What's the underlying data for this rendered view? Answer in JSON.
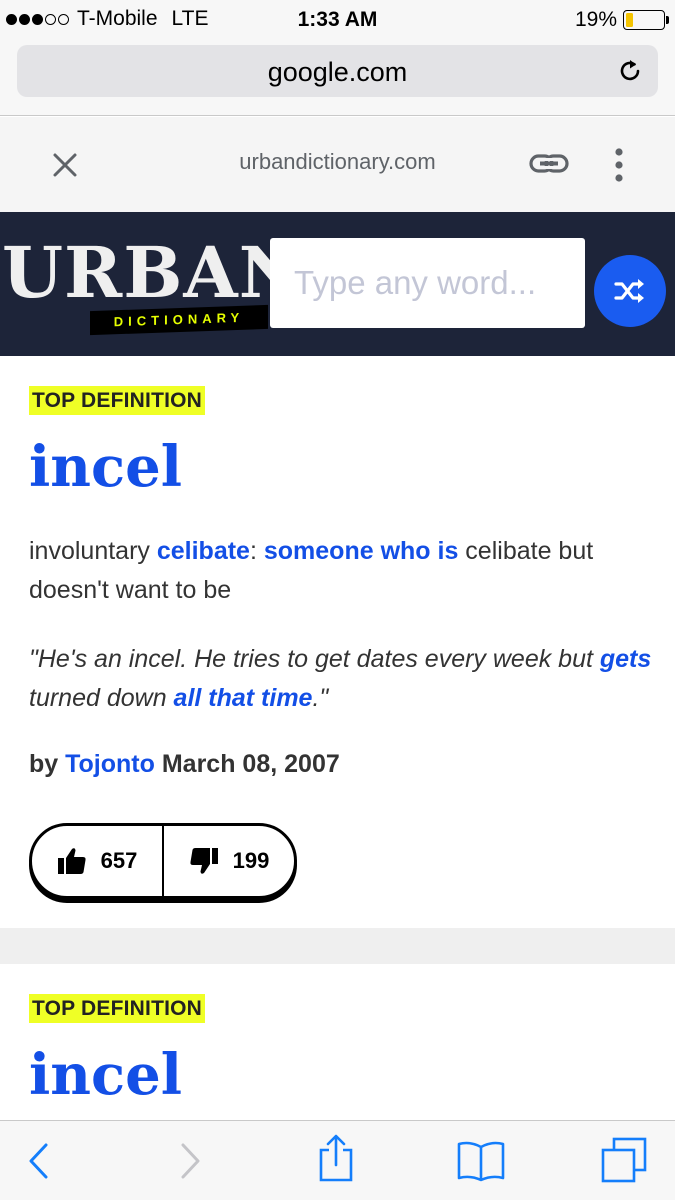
{
  "status_bar": {
    "carrier": "T-Mobile",
    "network": "LTE",
    "time": "1:33 AM",
    "battery": "19%",
    "battery_level": 0.19,
    "signal_bars": 3
  },
  "browser": {
    "address": "google.com",
    "reload_icon": "reload-icon"
  },
  "amp_viewer": {
    "domain": "urbandictionary.com",
    "close_icon": "close-icon",
    "link_icon": "link-icon",
    "more_icon": "more-vertical-icon"
  },
  "header": {
    "logo_word": "URBAN",
    "logo_tag": "DICTIONARY",
    "search_placeholder": "Type any word...",
    "random_icon": "shuffle-icon",
    "bg_color": "#1d2439",
    "accent_color": "#134fe6"
  },
  "definition": {
    "badge": "TOP DEFINITION",
    "word": "incel",
    "meaning": {
      "t1": "involuntary ",
      "l1": "celibate",
      "t2": ": ",
      "l2": "someone who is",
      "t3": " celibate but doesn't want to be"
    },
    "example": {
      "t1": "\"He's an incel. He tries to get dates every week but ",
      "l1": "gets",
      "t2": " turned down ",
      "l2": "all that time",
      "t3": ".\""
    },
    "byline": {
      "prefix": "by ",
      "author": "Tojonto",
      "date": " March 08, 2007"
    },
    "upvotes": "657",
    "downvotes": "199"
  },
  "definition2": {
    "badge": "TOP DEFINITION",
    "word": "incel"
  },
  "toolbar": {
    "back_icon": "back-icon",
    "forward_icon": "forward-icon",
    "share_icon": "share-icon",
    "bookmarks_icon": "bookmarks-icon",
    "tabs_icon": "tabs-icon"
  }
}
